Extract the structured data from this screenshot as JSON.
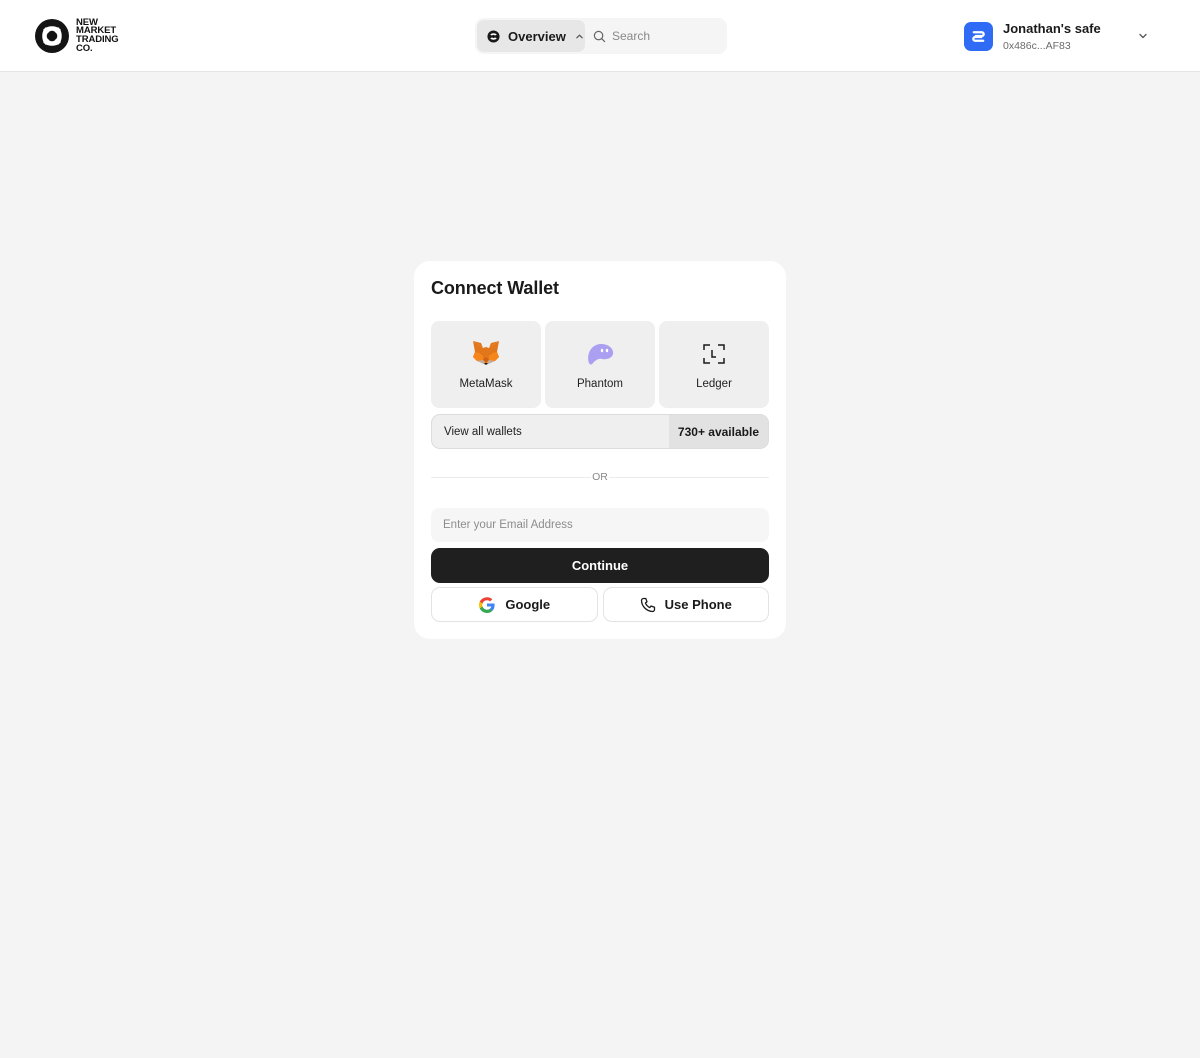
{
  "header": {
    "logo": {
      "lines": [
        "NEW",
        "MARKET",
        "TRADING",
        "CO."
      ]
    },
    "nav": {
      "overview_label": "Overview",
      "search_placeholder": "Search"
    },
    "account": {
      "name": "Jonathan's safe",
      "address": "0x486c...AF83"
    }
  },
  "card": {
    "title": "Connect Wallet",
    "wallets": [
      {
        "label": "MetaMask",
        "icon": "metamask-fox-icon"
      },
      {
        "label": "Phantom",
        "icon": "phantom-ghost-icon"
      },
      {
        "label": "Ledger",
        "icon": "ledger-icon"
      }
    ],
    "view_all": {
      "label": "View all wallets",
      "badge": "730+ available"
    },
    "divider_text": "OR",
    "email_placeholder": "Enter your Email Address",
    "continue_label": "Continue",
    "google_label": "Google",
    "phone_label": "Use Phone"
  },
  "colors": {
    "page_bg": "#f4f4f4",
    "card_bg": "#ffffff",
    "primary_button": "#1f1f1f",
    "account_avatar": "#2f6bf5",
    "phantom_purple": "#ab9ff2",
    "metamask_orange": "#e2761b"
  }
}
